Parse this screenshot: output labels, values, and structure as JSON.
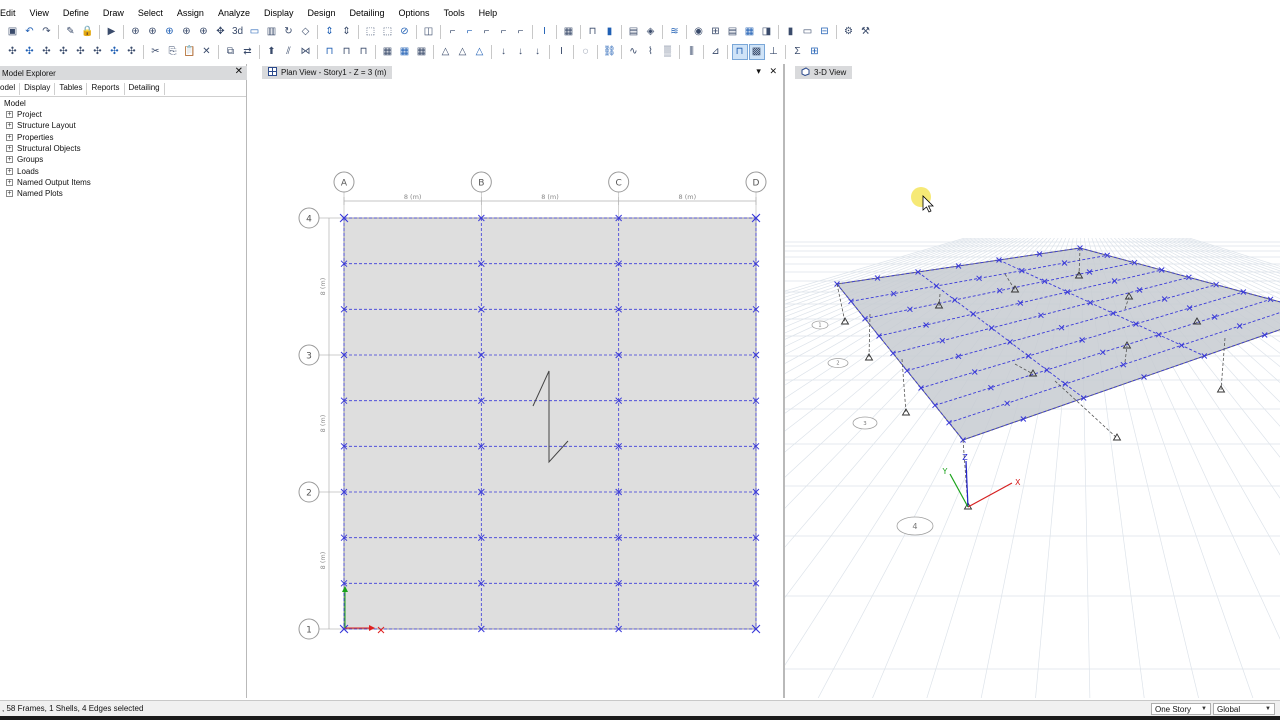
{
  "menubar": {
    "items": [
      "Edit",
      "View",
      "Define",
      "Draw",
      "Select",
      "Assign",
      "Analyze",
      "Display",
      "Design",
      "Detailing",
      "Options",
      "Tools",
      "Help"
    ]
  },
  "toolbar1": {
    "groups": [
      [
        "save-icon",
        "undo-icon",
        "redo-icon",
        "sep",
        "pencil-icon",
        "lock-icon",
        "sep",
        "run-icon",
        "sep",
        "zoom-window-icon",
        "zoom-in-icon",
        "zoom-out-icon",
        "zoom-all-icon",
        "zoom-prev-icon",
        "pan-icon",
        "3d-view-icon",
        "plan-view-icon",
        "elevation-view-icon",
        "rotate-icon",
        "perspective-icon",
        "sep",
        "move-up-icon",
        "move-down-icon",
        "sep",
        "select-all-icon",
        "select-prev-icon",
        "clear-selection-icon",
        "sep",
        "object-shrink-icon",
        "sep",
        "draw-frame-icon",
        "draw-brace-icon",
        "draw-column-icon",
        "draw-beam-icon",
        "draw-shell-icon",
        "sep",
        "section-icon",
        "sep",
        "shell-properties-icon",
        "sep",
        "frame-section-icon",
        "wall-section-icon",
        "sep",
        "display-icon",
        "assign-icon",
        "sep",
        "rebar-icon",
        "sep",
        "analyze-icon",
        "design-icon",
        "report-icon",
        "table-icon",
        "detailing-icon",
        "sep",
        "wall-design-icon",
        "slab-design-icon",
        "composite-icon",
        "sep",
        "options-icon",
        "tools-icon"
      ]
    ]
  },
  "toolbar2": {
    "groups": [
      [
        "snap-point-icon",
        "snap-end-icon",
        "snap-mid-icon",
        "snap-intersection-icon",
        "snap-perpendicular-icon",
        "snap-line-icon",
        "snap-grid-icon",
        "snap-fine-icon",
        "sep",
        "cut-icon",
        "copy-icon",
        "paste-icon",
        "delete-icon",
        "sep",
        "replicate-icon",
        "mirror-icon",
        "sep",
        "extrude-icon",
        "divide-icon",
        "join-icon",
        "sep",
        "frame-release-icon",
        "frame-offset-icon",
        "frame-insertion-icon",
        "sep",
        "shell-mesh-icon",
        "shell-edge-icon",
        "shell-openings-icon",
        "sep",
        "joint-restraint-icon",
        "joint-spring-icon",
        "joint-mass-icon",
        "sep",
        "load-point-icon",
        "load-frame-icon",
        "load-shell-icon",
        "sep",
        "section-cut-icon",
        "sep",
        "hinge-icon",
        "sep",
        "link-icon",
        "sep",
        "deformed-shape-icon",
        "force-diagram-icon",
        "stress-contour-icon",
        "sep",
        "story-response-icon",
        "sep",
        "member-forces-icon",
        "sep",
        "frame-design-icon",
        "concrete-design-icon",
        "steel-design-icon",
        "sep",
        "calc-icon",
        "table-edit-icon"
      ]
    ]
  },
  "explorer": {
    "title": "Model Explorer",
    "close": "✕",
    "tabs": [
      "odel",
      "Display",
      "Tables",
      "Reports",
      "Detailing"
    ],
    "root": "Model",
    "items": [
      "Project",
      "Structure Layout",
      "Properties",
      "Structural Objects",
      "Groups",
      "Loads",
      "Named Output Items",
      "Named Plots"
    ]
  },
  "plan_view": {
    "tab_label": "Plan View - Story1 - Z = 3 (m)",
    "grid_x_labels": [
      "A",
      "B",
      "C",
      "D"
    ],
    "grid_y_labels": [
      "4",
      "3",
      "2",
      "1"
    ],
    "dimension_label": "8 (m)",
    "grid_spacing_m": 8,
    "grid_count_x": 4,
    "grid_count_y": 4,
    "beam_subdivisions_per_bay": 3,
    "colors": {
      "slab_fill": "#dedede",
      "grid_line": "#3b3bd9",
      "marker": "#3b3bd9",
      "axis_x": "#e02020",
      "axis_y": "#1aa31a"
    }
  },
  "view3d": {
    "tab_label": "3-D View",
    "axis_labels": {
      "x": "X",
      "y": "Y",
      "z": "Z"
    },
    "grid_bubble_labels": [
      "1",
      "2",
      "3",
      "4"
    ],
    "colors": {
      "grid": "#dde3ea",
      "slab": "#c7cbd1",
      "beam": "#3b3bd9",
      "column": "#555555",
      "cursor": "#f2df3c"
    }
  },
  "statusbar": {
    "selection_text": ", 58 Frames, 1 Shells, 4 Edges selected",
    "story_value": "One Story",
    "coord_value": "Global"
  }
}
